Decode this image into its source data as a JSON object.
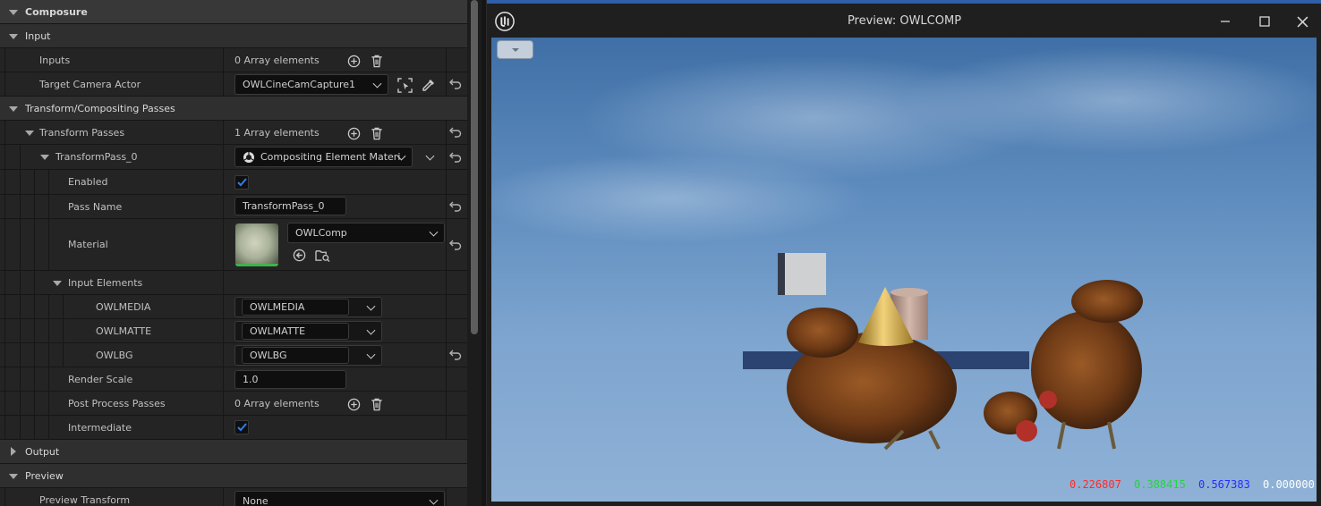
{
  "details": {
    "categories": {
      "composure": "Composure",
      "input": "Input",
      "transform": "Transform/Compositing Passes",
      "output": "Output",
      "preview": "Preview"
    },
    "inputs": {
      "label": "Inputs",
      "value": "0 Array elements"
    },
    "target_camera": {
      "label": "Target Camera Actor",
      "value": "OWLCineCamCapture1"
    },
    "transform_passes": {
      "label": "Transform Passes",
      "value": "1 Array elements"
    },
    "transform_pass_0": {
      "label": "TransformPass_0",
      "value": "Compositing Element Materi"
    },
    "enabled": {
      "label": "Enabled",
      "checked": true
    },
    "pass_name": {
      "label": "Pass Name",
      "value": "TransformPass_0"
    },
    "material": {
      "label": "Material",
      "value": "OWLComp"
    },
    "input_elements": {
      "label": "Input Elements",
      "items": [
        {
          "label": "OWLMEDIA",
          "value": "OWLMEDIA"
        },
        {
          "label": "OWLMATTE",
          "value": "OWLMATTE"
        },
        {
          "label": "OWLBG",
          "value": "OWLBG"
        }
      ]
    },
    "render_scale": {
      "label": "Render Scale",
      "value": "1.0"
    },
    "post_process": {
      "label": "Post Process Passes",
      "value": "0 Array elements"
    },
    "intermediate": {
      "label": "Intermediate",
      "checked": true
    },
    "preview_transform": {
      "label": "Preview Transform",
      "value": "None"
    }
  },
  "preview": {
    "title": "Preview: OWLCOMP",
    "pixel_values": {
      "r": "0.226807",
      "g": "0.388415",
      "b": "0.567383",
      "a": "0.000000"
    }
  },
  "colors": {
    "accent": "#2f5fa8",
    "check": "#2d7ee8",
    "pixel_r": "#ff2a2a",
    "pixel_g": "#22d63a",
    "pixel_b": "#2a2aff",
    "pixel_a": "#ffffff"
  },
  "icons": {
    "add": "plus-circle-icon",
    "delete": "trash-icon",
    "reset": "reset-arrow-icon",
    "pick_actor": "select-actor-icon",
    "eyedropper": "eyedropper-icon",
    "browse": "browse-arrow-icon",
    "find": "find-in-browser-icon",
    "material_class": "material-class-icon",
    "engine_logo": "unreal-logo-icon",
    "minimize": "minimize-icon",
    "maximize": "maximize-icon",
    "close": "close-icon"
  }
}
